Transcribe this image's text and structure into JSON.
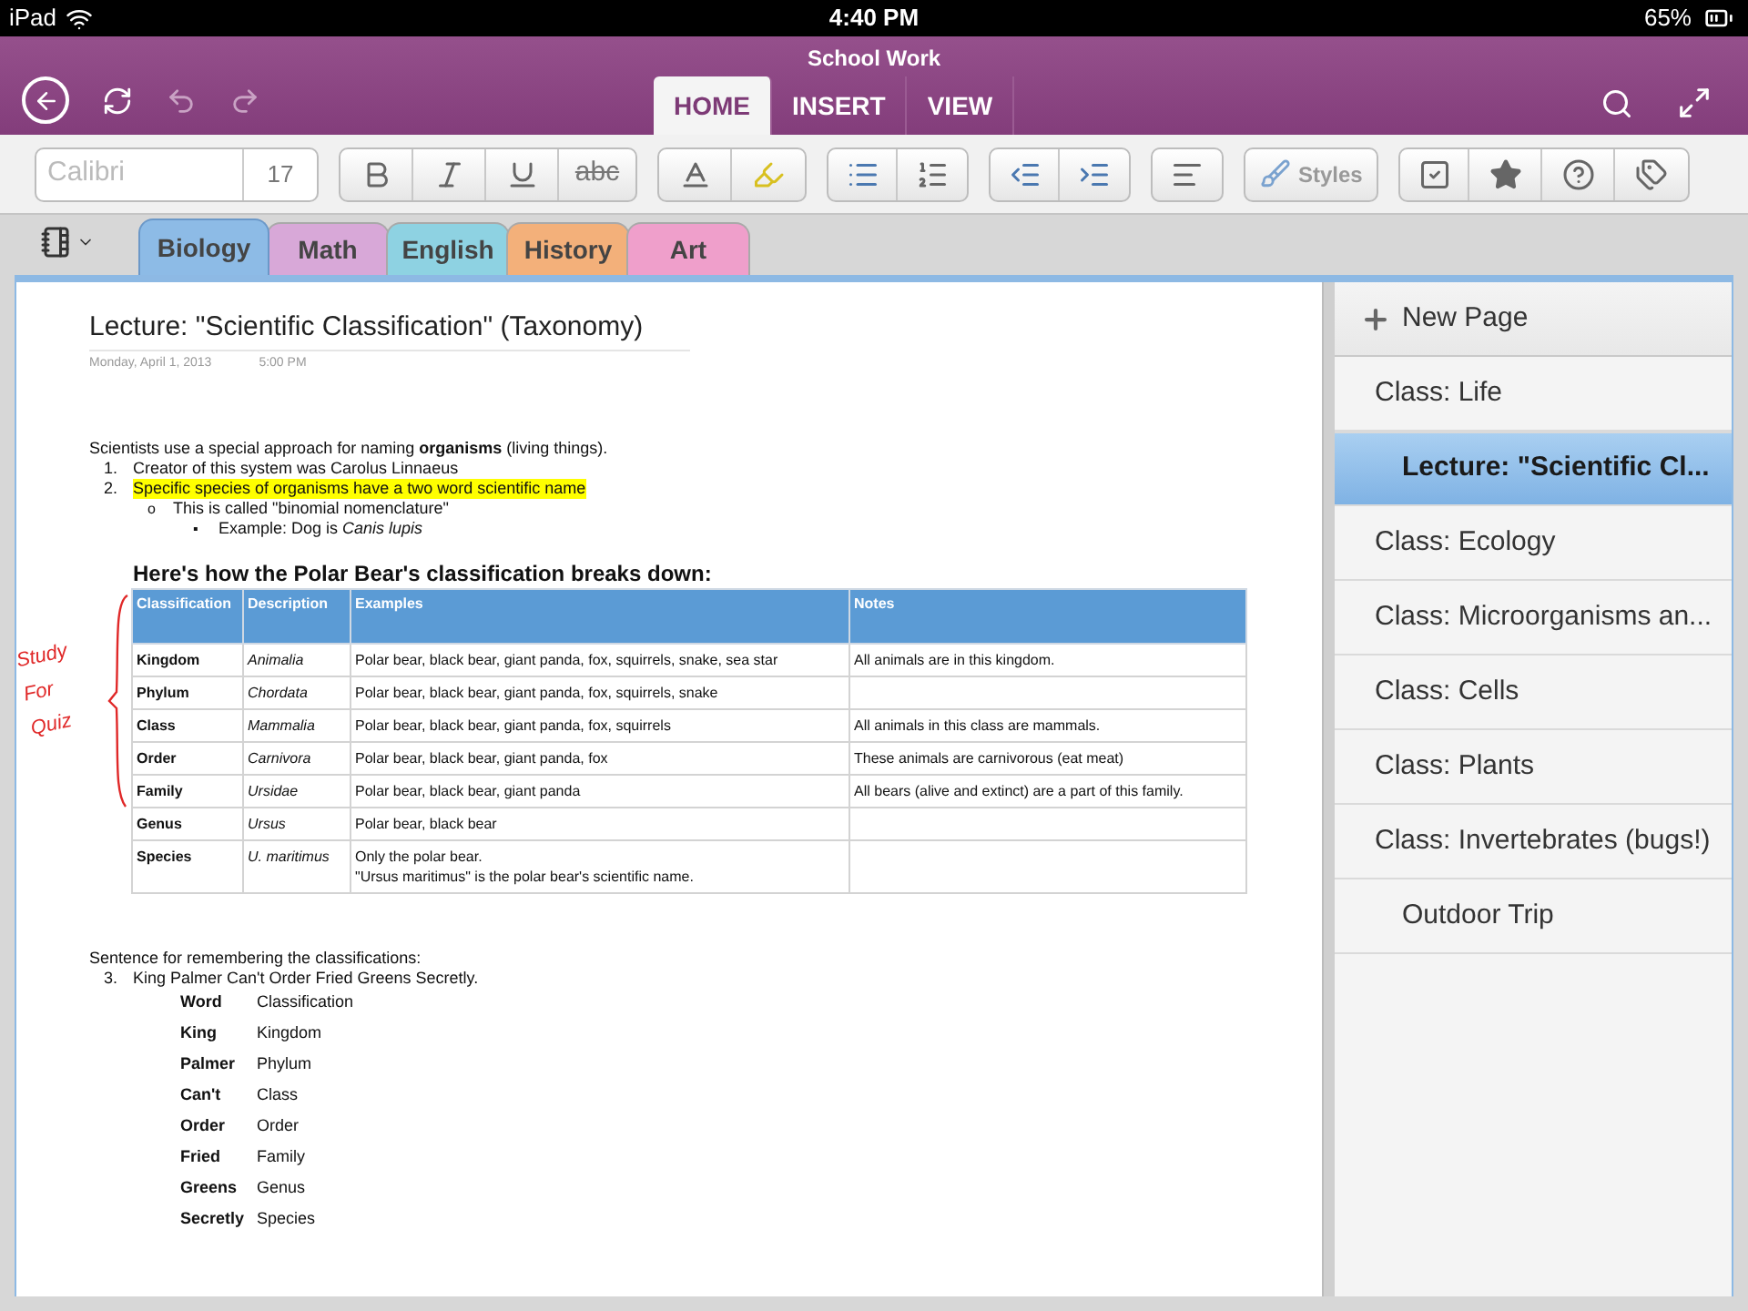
{
  "status_bar": {
    "device": "iPad",
    "time": "4:40 PM",
    "battery": "65%"
  },
  "window": {
    "title": "School Work"
  },
  "ribbon_tabs": [
    {
      "label": "HOME",
      "selected": true
    },
    {
      "label": "INSERT",
      "selected": false
    },
    {
      "label": "VIEW",
      "selected": false
    }
  ],
  "toolbar": {
    "font": "Calibri",
    "size": "17",
    "strike_label": "abc",
    "styles_label": "Styles"
  },
  "sections": [
    {
      "label": "Biology",
      "color": "#8dbbe6",
      "selected": true
    },
    {
      "label": "Math",
      "color": "#d8a8d8",
      "selected": false
    },
    {
      "label": "English",
      "color": "#8ed2e2",
      "selected": false
    },
    {
      "label": "History",
      "color": "#f3b07a",
      "selected": false
    },
    {
      "label": "Art",
      "color": "#ef9fcb",
      "selected": false
    }
  ],
  "note": {
    "title": "Lecture: \"Scientific Classification\" (Taxonomy)",
    "date": "Monday, April 1, 2013",
    "time": "5:00 PM",
    "intro": "Scientists use a special approach for naming **organisms** (living things).",
    "list": [
      {
        "number": "1.",
        "text": "Creator of this system was Carolus Linnaeus",
        "highlighted": false
      },
      {
        "number": "2.",
        "text": "Specific species of organisms have a two word scientific name",
        "highlighted": true,
        "children": [
          {
            "marker": "o",
            "text": "This is called \"binomial nomenclature\"",
            "children": [
              {
                "marker": "▪",
                "text": "Example:  Dog is *Canis lupis*"
              }
            ]
          }
        ]
      }
    ],
    "table_heading": "Here's how the Polar Bear's classification breaks down:",
    "ink_note": [
      "Study",
      "For",
      "Quiz"
    ],
    "table": {
      "columns": [
        "Classification",
        "Description",
        "Examples",
        "Notes"
      ],
      "rows": [
        [
          "Kingdom",
          "Animalia",
          "Polar bear, black bear, giant panda, fox, squirrels, snake, sea star",
          "All animals are in this kingdom."
        ],
        [
          "Phylum",
          "Chordata",
          "Polar bear, black bear, giant panda, fox, squirrels, snake",
          ""
        ],
        [
          "Class",
          "Mammalia",
          "Polar bear, black bear, giant panda, fox, squirrels",
          "All animals in this class are mammals."
        ],
        [
          "Order",
          "Carnivora",
          "Polar bear, black bear, giant panda, fox",
          "These animals are carnivorous (eat meat)"
        ],
        [
          "Family",
          "Ursidae",
          "Polar bear, black bear, giant panda",
          "All bears (alive and extinct) are a part of this family."
        ],
        [
          "Genus",
          "Ursus",
          "Polar bear, black bear",
          ""
        ],
        [
          "Species",
          "U. maritimus",
          "Only the polar bear.\n\"Ursus maritimus\" is the polar bear's scientific name.",
          ""
        ]
      ]
    },
    "sentence_intro": "Sentence for remembering the classifications:",
    "sentence": {
      "number": "3.",
      "text": "King Palmer Can't Order Fried Greens Secretly."
    },
    "mnemonic": [
      [
        "Word",
        "Classification"
      ],
      [
        "King",
        "Kingdom"
      ],
      [
        "Palmer",
        "Phylum"
      ],
      [
        "Can't",
        "Class"
      ],
      [
        "Order",
        "Order"
      ],
      [
        "Fried",
        "Family"
      ],
      [
        "Greens",
        "Genus"
      ],
      [
        "Secretly",
        "Species"
      ]
    ]
  },
  "sidebar": {
    "new_page": "New Page",
    "pages": [
      {
        "label": "Class:  Life",
        "selected": false,
        "children": [
          {
            "label": "Lecture: \"Scientific Cl...",
            "selected": true
          }
        ]
      },
      {
        "label": "Class: Ecology",
        "selected": false
      },
      {
        "label": "Class: Microorganisms an...",
        "selected": false
      },
      {
        "label": "Class: Cells",
        "selected": false
      },
      {
        "label": "Class: Plants",
        "selected": false
      },
      {
        "label": "Class: Invertebrates (bugs!)",
        "selected": false,
        "children": [
          {
            "label": "Outdoor Trip",
            "selected": false
          }
        ]
      }
    ]
  }
}
